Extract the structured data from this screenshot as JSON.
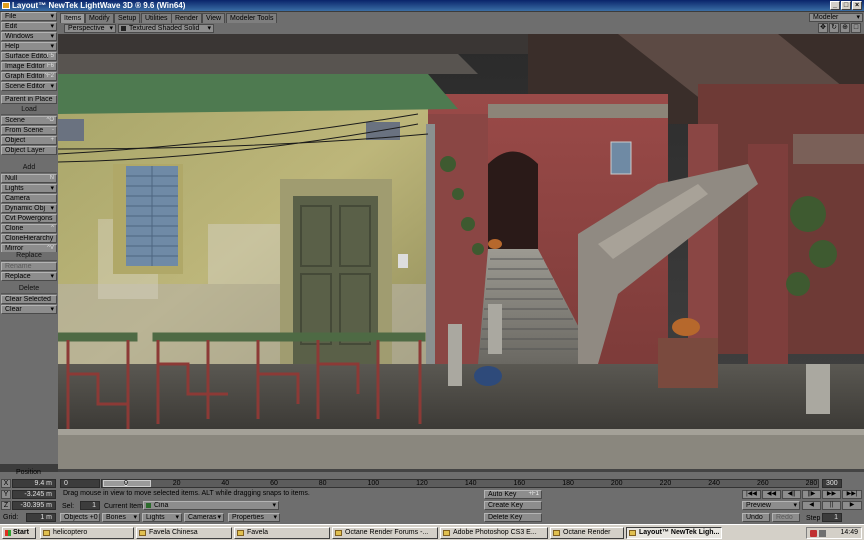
{
  "window": {
    "title": "Layout™ NewTek LightWave 3D ® 9.6  (Win64)",
    "buttons": [
      "_",
      "□",
      "×"
    ]
  },
  "left_panel": {
    "top_items": [
      {
        "label": "File",
        "dropdown": true
      },
      {
        "label": "Edit",
        "dropdown": true
      },
      {
        "label": "Windows",
        "dropdown": true
      },
      {
        "label": "Help",
        "dropdown": true
      },
      {
        "label": "Surface Editor",
        "key": "F5"
      },
      {
        "label": "Image Editor",
        "key": "F6"
      },
      {
        "label": "Graph Editor",
        "key": "^F2"
      },
      {
        "label": "Scene Editor",
        "dropdown": true
      },
      {
        "label": "Parent in Place"
      }
    ],
    "load_header": "Load",
    "load_items": [
      {
        "label": "Scene",
        "key": "^O"
      },
      {
        "label": "From Scene",
        "key": "-"
      },
      {
        "label": "Object",
        "key": "+"
      },
      {
        "label": "Object Layer"
      }
    ],
    "add_header": "Add",
    "add_items": [
      {
        "label": "Null",
        "key": "N"
      },
      {
        "label": "Lights",
        "dropdown": true
      },
      {
        "label": "Camera"
      },
      {
        "label": "Dynamic Obj",
        "dropdown": true
      },
      {
        "label": "Cvt Powergons"
      },
      {
        "label": "Clone",
        "key": "^"
      },
      {
        "label": "CloneHierarchy"
      },
      {
        "label": "Mirror",
        "key": "^V"
      }
    ],
    "replace_header": "Replace",
    "replace_items": [
      {
        "label": "Rename",
        "dim": true
      },
      {
        "label": "Replace",
        "dropdown": true
      }
    ],
    "delete_header": "Delete",
    "delete_items": [
      {
        "label": "Clear Selected"
      },
      {
        "label": "Clear",
        "dropdown": true
      }
    ]
  },
  "tabs": [
    {
      "label": "Items",
      "active": true
    },
    {
      "label": "Modify"
    },
    {
      "label": "Setup"
    },
    {
      "label": "Utilities"
    },
    {
      "label": "Render"
    },
    {
      "label": "View"
    },
    {
      "label": "Modeler Tools"
    }
  ],
  "modeler_switch": "Modeler",
  "viewport_toolbar": {
    "view_mode": "Perspective",
    "shading": "Textured Shaded Solid"
  },
  "nav_icons": [
    "move-icon",
    "rotate-icon",
    "zoom-icon",
    "maximize-icon"
  ],
  "bottom": {
    "position_label": "Position",
    "x_label": "X",
    "x_value": "9.4 m",
    "y_label": "Y",
    "y_value": "-3.245 m",
    "z_label": "Z",
    "z_value": "-30.395 m",
    "grid_label": "Grid:",
    "grid_value": "1 m",
    "timeline_ticks": [
      "0",
      "20",
      "40",
      "60",
      "80",
      "100",
      "120",
      "140",
      "160",
      "180",
      "200",
      "220",
      "240",
      "260",
      "280"
    ],
    "current_frame": "0",
    "end_frame": "300",
    "status_message": "Drag mouse in view to move selected items. ALT while dragging snaps to items.",
    "auto_key": "Auto Key",
    "auto_key_shortcut": "+F1",
    "create_key": "Create Key",
    "delete_key": "Delete Key",
    "sel_label": "Sel:",
    "sel_value": "1",
    "current_item_label": "Current Item",
    "current_item_value": "Cina",
    "objects_label": "Objects",
    "objects_count": "+0",
    "bones_label": "Bones",
    "lights_label": "Lights",
    "cameras_label": "Cameras",
    "properties_label": "Properties",
    "transport": [
      "|◀◀",
      "◀◀",
      "◀||",
      "||▶",
      "▶▶",
      "▶▶|"
    ],
    "preview_label": "Preview",
    "play_back": "◀",
    "pause": "||",
    "play_fwd": "▶",
    "undo_label": "Undo",
    "redo_label": "Redo",
    "step_label": "Step",
    "step_value": "1"
  },
  "taskbar": {
    "start_label": "Start",
    "tasks": [
      {
        "label": "helicoptero"
      },
      {
        "label": "Favela Chinesa"
      },
      {
        "label": "Favela"
      },
      {
        "label": "Octane Render Forums -..."
      },
      {
        "label": "Adobe Photoshop CS3 E..."
      },
      {
        "label": "Octane Render"
      },
      {
        "label": "Layout™ NewTek Ligh...",
        "active": true
      }
    ],
    "clock": "14:49"
  }
}
